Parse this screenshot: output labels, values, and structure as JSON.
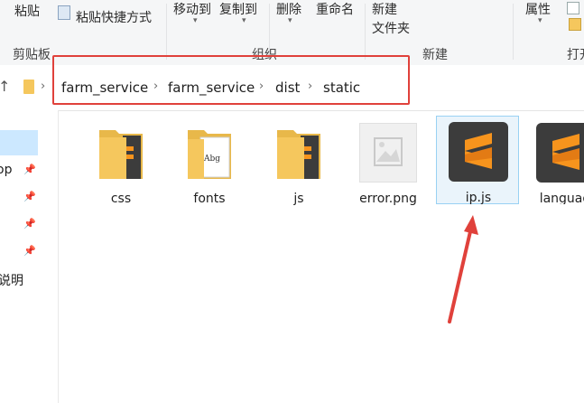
{
  "ribbon": {
    "paste": "粘贴",
    "paste_shortcut": "粘贴快捷方式",
    "clipboard_group": "剪贴板",
    "move_to": "移动到",
    "copy_to": "复制到",
    "delete": "删除",
    "rename": "重命名",
    "organize_group": "组织",
    "new_folder_line1": "新建",
    "new_folder_line2": "文件夹",
    "new_group": "新建",
    "properties": "属性",
    "open_group": "打开"
  },
  "address": {
    "crumbs": [
      "farm_service",
      "farm_service",
      "dist",
      "static"
    ]
  },
  "nav": {
    "item1": "op",
    "item2": "说明"
  },
  "files": [
    {
      "name": "css",
      "type": "folder"
    },
    {
      "name": "fonts",
      "type": "folder"
    },
    {
      "name": "js",
      "type": "folder"
    },
    {
      "name": "error.png",
      "type": "image"
    },
    {
      "name": "ip.js",
      "type": "sublime-file",
      "selected": true
    },
    {
      "name": "languag\nxt",
      "type": "sublime-file"
    }
  ],
  "colors": {
    "annotation_red": "#e0413b",
    "sublime_orange": "#f7941d",
    "folder_yellow": "#f5c75d",
    "selection_blue": "#99d1f3"
  }
}
